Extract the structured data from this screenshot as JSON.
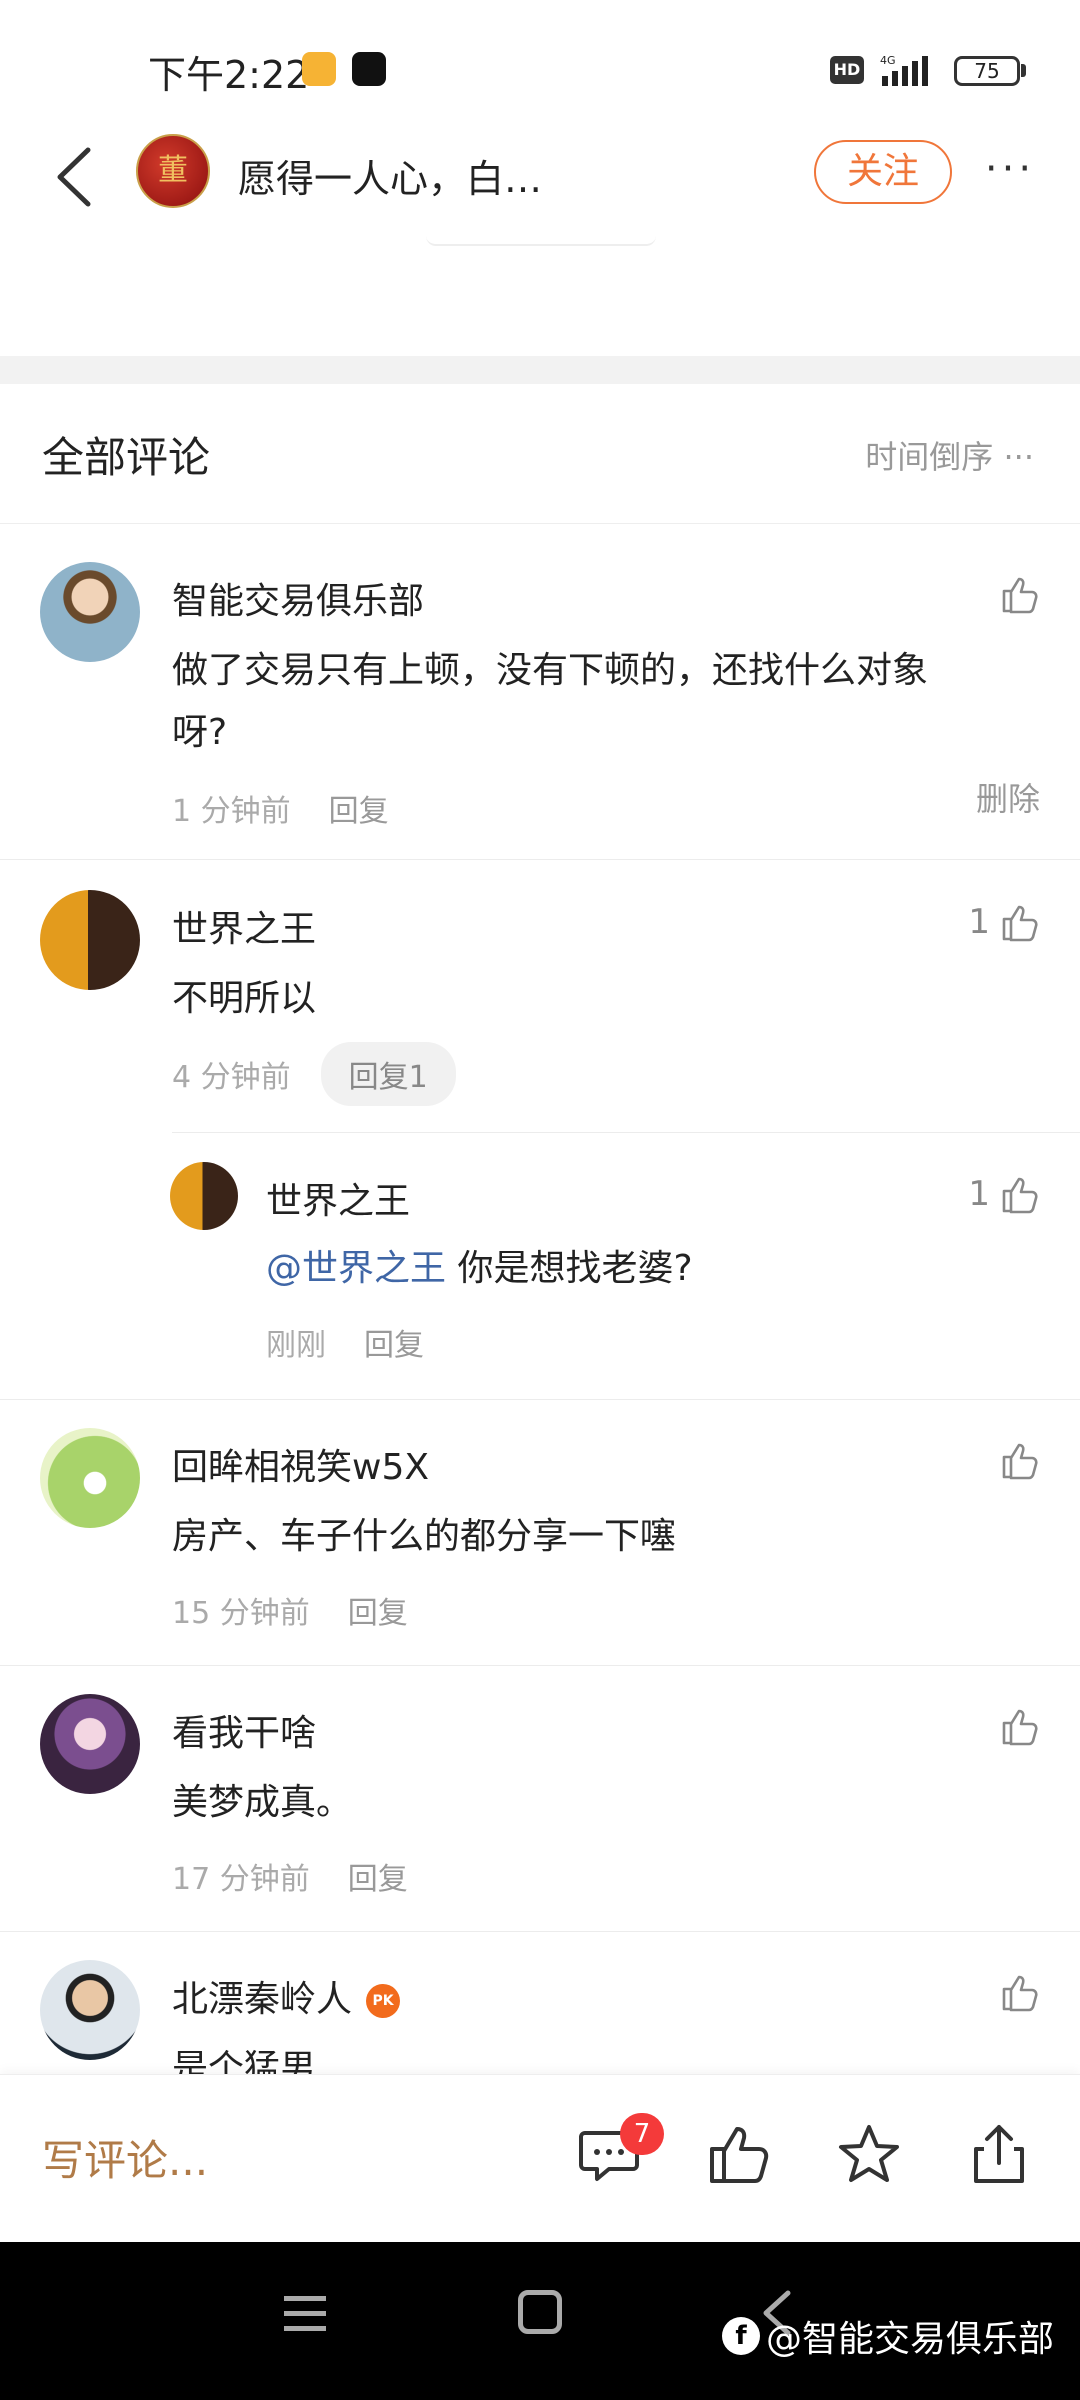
{
  "status_bar": {
    "time": "下午2:22",
    "network": "4G",
    "hd": "HD",
    "battery": "75"
  },
  "header": {
    "avatar_text": "董",
    "title": "愿得一人心，白…",
    "follow_label": "关注",
    "more_label": "···"
  },
  "comments_section": {
    "title": "全部评论",
    "sort_label": "时间倒序 ···"
  },
  "comments": [
    {
      "name": "智能交易俱乐部",
      "text": "做了交易只有上顿，没有下顿的，还找什么对象呀?",
      "time": "1 分钟前",
      "reply_label": "回复",
      "likes": "",
      "delete_label": "删除"
    },
    {
      "name": "世界之王",
      "text": "不明所以",
      "time": "4 分钟前",
      "reply_label": "回复1",
      "likes": "1"
    },
    {
      "name": "回眸相視笑w5X",
      "text": "房产、车子什么的都分享一下噻",
      "time": "15 分钟前",
      "reply_label": "回复",
      "likes": ""
    },
    {
      "name": "看我干啥",
      "text": "美梦成真。",
      "time": "17 分钟前",
      "reply_label": "回复",
      "likes": ""
    },
    {
      "name": "北漂秦岭人",
      "badge": "PK",
      "text": "是个猛男",
      "likes": ""
    }
  ],
  "sub_reply": {
    "name": "世界之王",
    "mention": "@世界之王",
    "text": " 你是想找老婆?",
    "time": "刚刚",
    "reply_label": "回复",
    "likes": "1"
  },
  "bottom_bar": {
    "write_placeholder": "写评论...",
    "comment_count": "7"
  },
  "watermark": {
    "icon_letter": "f",
    "text": "@智能交易俱乐部"
  },
  "colors": {
    "accent_orange": "#f0763a",
    "mention_blue": "#3f66a6",
    "badge_red": "#f43a3a"
  }
}
